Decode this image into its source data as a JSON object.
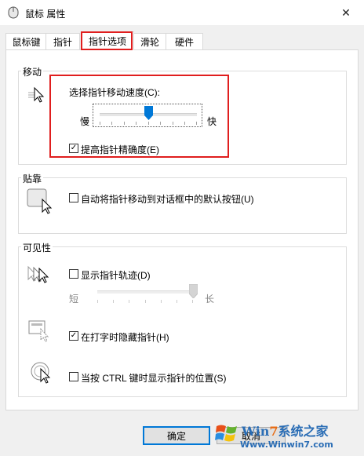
{
  "window": {
    "title": "鼠标 属性",
    "close_glyph": "✕"
  },
  "tabs": [
    {
      "label": "鼠标键"
    },
    {
      "label": "指针"
    },
    {
      "label": "指针选项"
    },
    {
      "label": "滑轮"
    },
    {
      "label": "硬件"
    }
  ],
  "active_tab": "指针选项",
  "motion": {
    "group_label": "移动",
    "speed_label": "选择指针移动速度(C):",
    "slow_label": "慢",
    "fast_label": "快",
    "speed_value": 0.5,
    "precision_label": "提高指针精确度(E)",
    "precision_checked": true
  },
  "snap": {
    "group_label": "贴靠",
    "snap_label": "自动将指针移动到对话框中的默认按钮(U)",
    "snap_checked": false
  },
  "visibility": {
    "group_label": "可见性",
    "trails_label": "显示指针轨迹(D)",
    "trails_checked": false,
    "short_label": "短",
    "long_label": "长",
    "trails_value": 1.0,
    "hide_label": "在打字时隐藏指针(H)",
    "hide_checked": true,
    "ctrl_label": "当按 CTRL 键时显示指针的位置(S)",
    "ctrl_checked": false
  },
  "buttons": {
    "ok": "确定",
    "cancel": "取消"
  },
  "watermark": {
    "line1_a": "Win",
    "line1_b": "7",
    "line1_c": "系统之家",
    "line2": "Www.Winwin7.com"
  },
  "colors": {
    "highlight": "#e01e1e",
    "accent": "#0078d7"
  }
}
